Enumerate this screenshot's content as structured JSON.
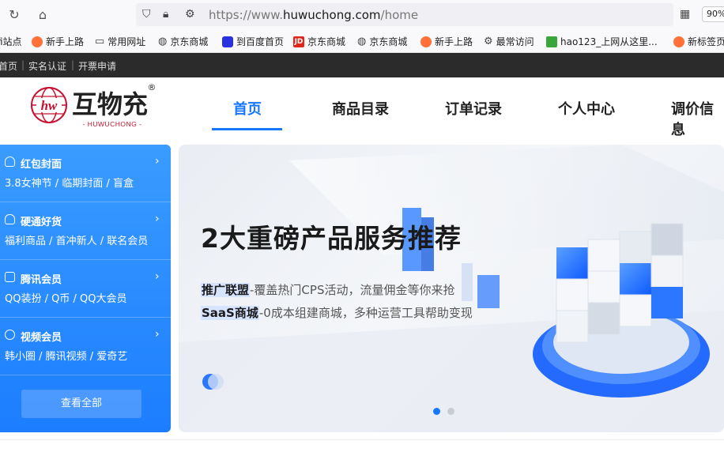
{
  "browser": {
    "url_prefix": "https://www.",
    "url_host": "huwuchong.com",
    "url_path": "/home",
    "zoom": "90%",
    "icons": {
      "reload": "reload-icon",
      "home": "home-icon",
      "shield": "shield-icon",
      "lock": "lock-icon",
      "perm": "permissions-icon",
      "qr": "qr-code-icon"
    }
  },
  "bookmarks": [
    {
      "label": "fi站点",
      "icon": "globe-icon"
    },
    {
      "label": "新手上路",
      "icon": "firefox-icon"
    },
    {
      "label": "常用网址",
      "icon": "folder-icon"
    },
    {
      "label": "京东商城",
      "icon": "globe-icon"
    },
    {
      "label": "到百度首页",
      "icon": "baidu-icon"
    },
    {
      "label": "京东商城",
      "icon": "jd-icon"
    },
    {
      "label": "京东商城",
      "icon": "globe-icon"
    },
    {
      "label": "新手上路",
      "icon": "firefox-icon"
    },
    {
      "label": "最常访问",
      "icon": "gear-icon"
    },
    {
      "label": "hao123_上网从这里...",
      "icon": "hao123-icon"
    },
    {
      "label": "新标签页",
      "icon": "firefox-icon"
    }
  ],
  "topbar": {
    "home": "首页",
    "sep1": "|",
    "verify": "实名认证",
    "sep2": "|",
    "invoice": "开票申请"
  },
  "logo": {
    "brand": "互物充",
    "sub": "- HUWUCHONG -",
    "mark": "hw",
    "reg": "®"
  },
  "menu": [
    "首页",
    "商品目录",
    "订单记录",
    "个人中心",
    "调价信息"
  ],
  "categories": [
    {
      "title": "红包封面",
      "sub": "3.8女神节 / 临期封面 / 盲盒",
      "arrow": "›"
    },
    {
      "title": "硬通好货",
      "sub": "福利商品 / 首冲新人 / 联名会员",
      "arrow": "›"
    },
    {
      "title": "腾讯会员",
      "sub": "QQ装扮 / Q币 / QQ大会员",
      "arrow": "›"
    },
    {
      "title": "视频会员",
      "sub": "韩小圈 / 腾讯视频 / 爱奇艺",
      "arrow": "›"
    }
  ],
  "view_all": "查看全部",
  "banner": {
    "title": "2大重磅产品服务推荐",
    "line1_hl": "推广联盟",
    "line1": "-覆盖热门CPS活动，流量佣金等你来抢",
    "line2_hl": "SaaS商城",
    "line2": "-0成本组建商城，多种运营工具帮助变现",
    "slides": 2,
    "active_slide": 1
  },
  "colors": {
    "accent": "#1677ff",
    "topbar": "#2b2b2b",
    "logo_red": "#c8102e"
  }
}
